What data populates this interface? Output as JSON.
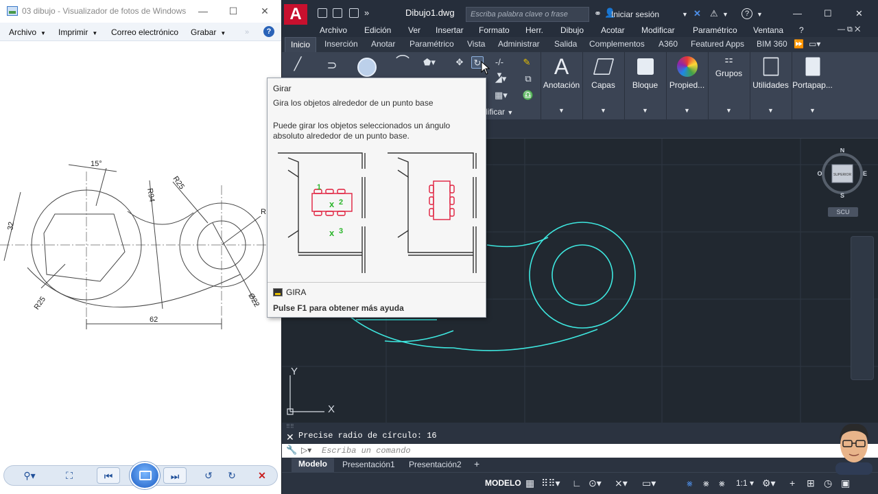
{
  "photo_viewer": {
    "title": "03 dibujo - Visualizador de fotos de Windows",
    "menu": [
      "Archivo",
      "Imprimir",
      "Correo electrónico",
      "Grabar"
    ],
    "help_label": "?",
    "drawing_labels": {
      "angle": "15°",
      "r94": "R94",
      "r25_top": "R25",
      "r_right": "R",
      "dim32": "32",
      "r25_bottom": "R25",
      "d22": "Ø22",
      "dim62": "62"
    }
  },
  "autocad": {
    "logo": "A",
    "doc_title": "Dibujo1.dwg",
    "search_placeholder": "Escriba palabra clave o frase",
    "signin": "Iniciar sesión",
    "menu": [
      "Archivo",
      "Edición",
      "Ver",
      "Insertar",
      "Formato",
      "Herr.",
      "Dibujo",
      "Acotar",
      "Modificar",
      "Paramétrico",
      "Ventana",
      "?"
    ],
    "tabs": [
      "Inicio",
      "Inserción",
      "Anotar",
      "Paramétrico",
      "Vista",
      "Administrar",
      "Salida",
      "Complementos",
      "A360",
      "Featured Apps",
      "BIM 360"
    ],
    "active_tab": "Inicio",
    "ribbon_panels": [
      "Anotación",
      "Capas",
      "Bloque",
      "Propied...",
      "Grupos",
      "Utilidades",
      "Portapap..."
    ],
    "modify_panel_label": "dificar",
    "viewcube": {
      "n": "N",
      "s": "S",
      "e": "E",
      "o": "O",
      "face": "SUPERIOR",
      "scu": "SCU"
    },
    "ucs": {
      "x": "X",
      "y": "Y"
    },
    "command_history": "Precise radio de círculo: 16",
    "command_placeholder": "Escriba un comando",
    "layout_tabs": [
      "Modelo",
      "Presentación1",
      "Presentación2"
    ],
    "add_tab": "+",
    "status_model": "MODELO",
    "status_scale": "1:1"
  },
  "tooltip": {
    "title": "Girar",
    "summary": "Gira los objetos alrededor de un punto base",
    "description": "Puede girar los objetos seleccionados un ángulo absoluto alrededor de un punto base.",
    "labels": {
      "p1": "1",
      "p2": "2",
      "p3": "3",
      "x": "x"
    },
    "command": "GIRA",
    "help": "Pulse F1 para obtener más ayuda"
  },
  "colors": {
    "autocad_red": "#c8102e",
    "cad_cyan": "#3ee8e0",
    "tooltip_green": "#2bb52b",
    "tooltip_red": "#e01e3c"
  }
}
